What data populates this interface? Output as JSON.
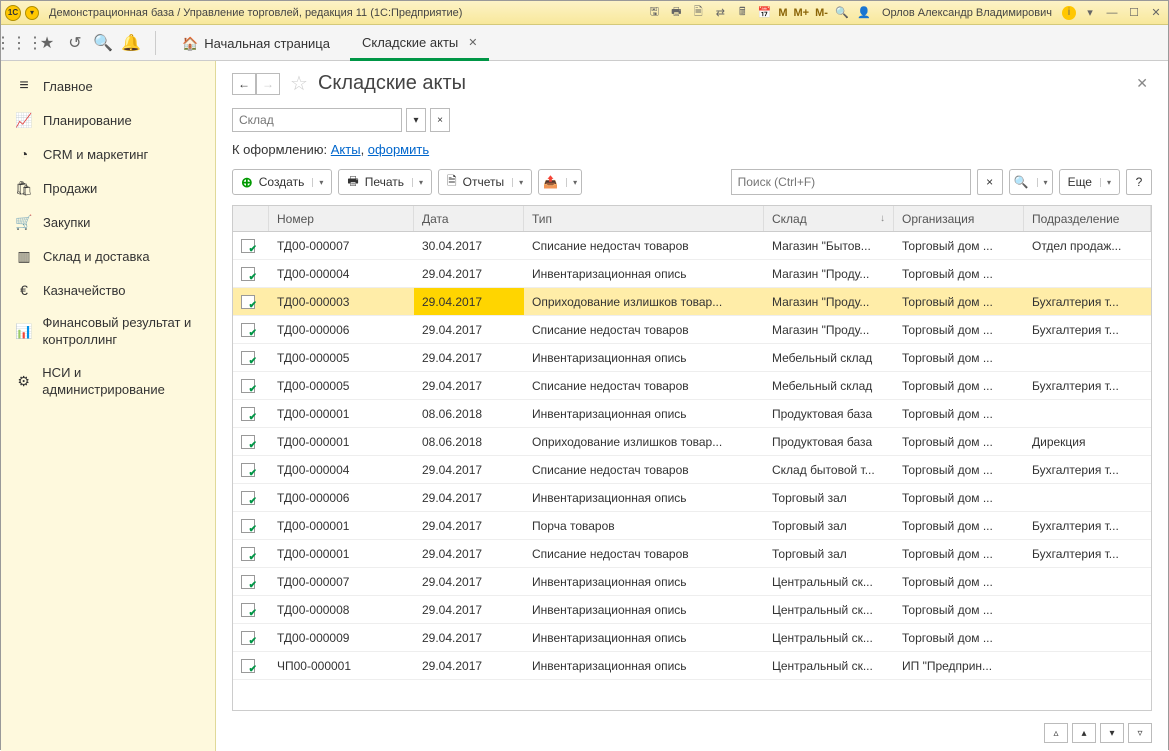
{
  "titlebar": {
    "title": "Демонстрационная база / Управление торговлей, редакция 11 (1С:Предприятие)",
    "user": "Орлов Александр Владимирович",
    "m": "M",
    "mplus": "M+",
    "mminus": "M-"
  },
  "tabs": {
    "start": "Начальная страница",
    "active": "Складские акты"
  },
  "sidebar": {
    "items": [
      {
        "label": "Главное"
      },
      {
        "label": "Планирование"
      },
      {
        "label": "CRM и маркетинг"
      },
      {
        "label": "Продажи"
      },
      {
        "label": "Закупки"
      },
      {
        "label": "Склад и доставка"
      },
      {
        "label": "Казначейство"
      },
      {
        "label": "Финансовый результат и контроллинг"
      },
      {
        "label": "НСИ и администрирование"
      }
    ]
  },
  "page": {
    "title": "Складские акты",
    "filter_placeholder": "Склад",
    "links_prefix": "К оформлению:  ",
    "link_acts": "Акты",
    "link_sep": ", ",
    "link_create": "оформить"
  },
  "actions": {
    "create": "Создать",
    "print": "Печать",
    "reports": "Отчеты",
    "search_placeholder": "Поиск (Ctrl+F)",
    "more": "Еще",
    "help": "?"
  },
  "columns": {
    "num": "Номер",
    "date": "Дата",
    "type": "Тип",
    "store": "Склад",
    "org": "Организация",
    "dept": "Подразделение"
  },
  "rows": [
    {
      "num": "ТД00-000007",
      "date": "30.04.2017",
      "type": "Списание недостач товаров",
      "store": "Магазин \"Бытов...",
      "org": "Торговый дом ...",
      "dept": "Отдел продаж..."
    },
    {
      "num": "ТД00-000004",
      "date": "29.04.2017",
      "type": "Инвентаризационная опись",
      "store": "Магазин \"Проду...",
      "org": "Торговый дом ...",
      "dept": ""
    },
    {
      "num": "ТД00-000003",
      "date": "29.04.2017",
      "type": "Оприходование излишков товар...",
      "store": "Магазин \"Проду...",
      "org": "Торговый дом ...",
      "dept": "Бухгалтерия т...",
      "selected": true
    },
    {
      "num": "ТД00-000006",
      "date": "29.04.2017",
      "type": "Списание недостач товаров",
      "store": "Магазин \"Проду...",
      "org": "Торговый дом ...",
      "dept": "Бухгалтерия т..."
    },
    {
      "num": "ТД00-000005",
      "date": "29.04.2017",
      "type": "Инвентаризационная опись",
      "store": "Мебельный склад",
      "org": "Торговый дом ...",
      "dept": ""
    },
    {
      "num": "ТД00-000005",
      "date": "29.04.2017",
      "type": "Списание недостач товаров",
      "store": "Мебельный склад",
      "org": "Торговый дом ...",
      "dept": "Бухгалтерия т..."
    },
    {
      "num": "ТД00-000001",
      "date": "08.06.2018",
      "type": "Инвентаризационная опись",
      "store": "Продуктовая база",
      "org": "Торговый дом ...",
      "dept": ""
    },
    {
      "num": "ТД00-000001",
      "date": "08.06.2018",
      "type": "Оприходование излишков товар...",
      "store": "Продуктовая база",
      "org": "Торговый дом ...",
      "dept": "Дирекция"
    },
    {
      "num": "ТД00-000004",
      "date": "29.04.2017",
      "type": "Списание недостач товаров",
      "store": "Склад бытовой т...",
      "org": "Торговый дом ...",
      "dept": "Бухгалтерия т..."
    },
    {
      "num": "ТД00-000006",
      "date": "29.04.2017",
      "type": "Инвентаризационная опись",
      "store": "Торговый зал",
      "org": "Торговый дом ...",
      "dept": ""
    },
    {
      "num": "ТД00-000001",
      "date": "29.04.2017",
      "type": "Порча товаров",
      "store": "Торговый зал",
      "org": "Торговый дом ...",
      "dept": "Бухгалтерия т..."
    },
    {
      "num": "ТД00-000001",
      "date": "29.04.2017",
      "type": "Списание недостач товаров",
      "store": "Торговый зал",
      "org": "Торговый дом ...",
      "dept": "Бухгалтерия т..."
    },
    {
      "num": "ТД00-000007",
      "date": "29.04.2017",
      "type": "Инвентаризационная опись",
      "store": "Центральный ск...",
      "org": "Торговый дом ...",
      "dept": ""
    },
    {
      "num": "ТД00-000008",
      "date": "29.04.2017",
      "type": "Инвентаризационная опись",
      "store": "Центральный ск...",
      "org": "Торговый дом ...",
      "dept": ""
    },
    {
      "num": "ТД00-000009",
      "date": "29.04.2017",
      "type": "Инвентаризационная опись",
      "store": "Центральный ск...",
      "org": "Торговый дом ...",
      "dept": ""
    },
    {
      "num": "ЧП00-000001",
      "date": "29.04.2017",
      "type": "Инвентаризационная опись",
      "store": "Центральный ск...",
      "org": "ИП \"Предприн...",
      "dept": ""
    }
  ]
}
